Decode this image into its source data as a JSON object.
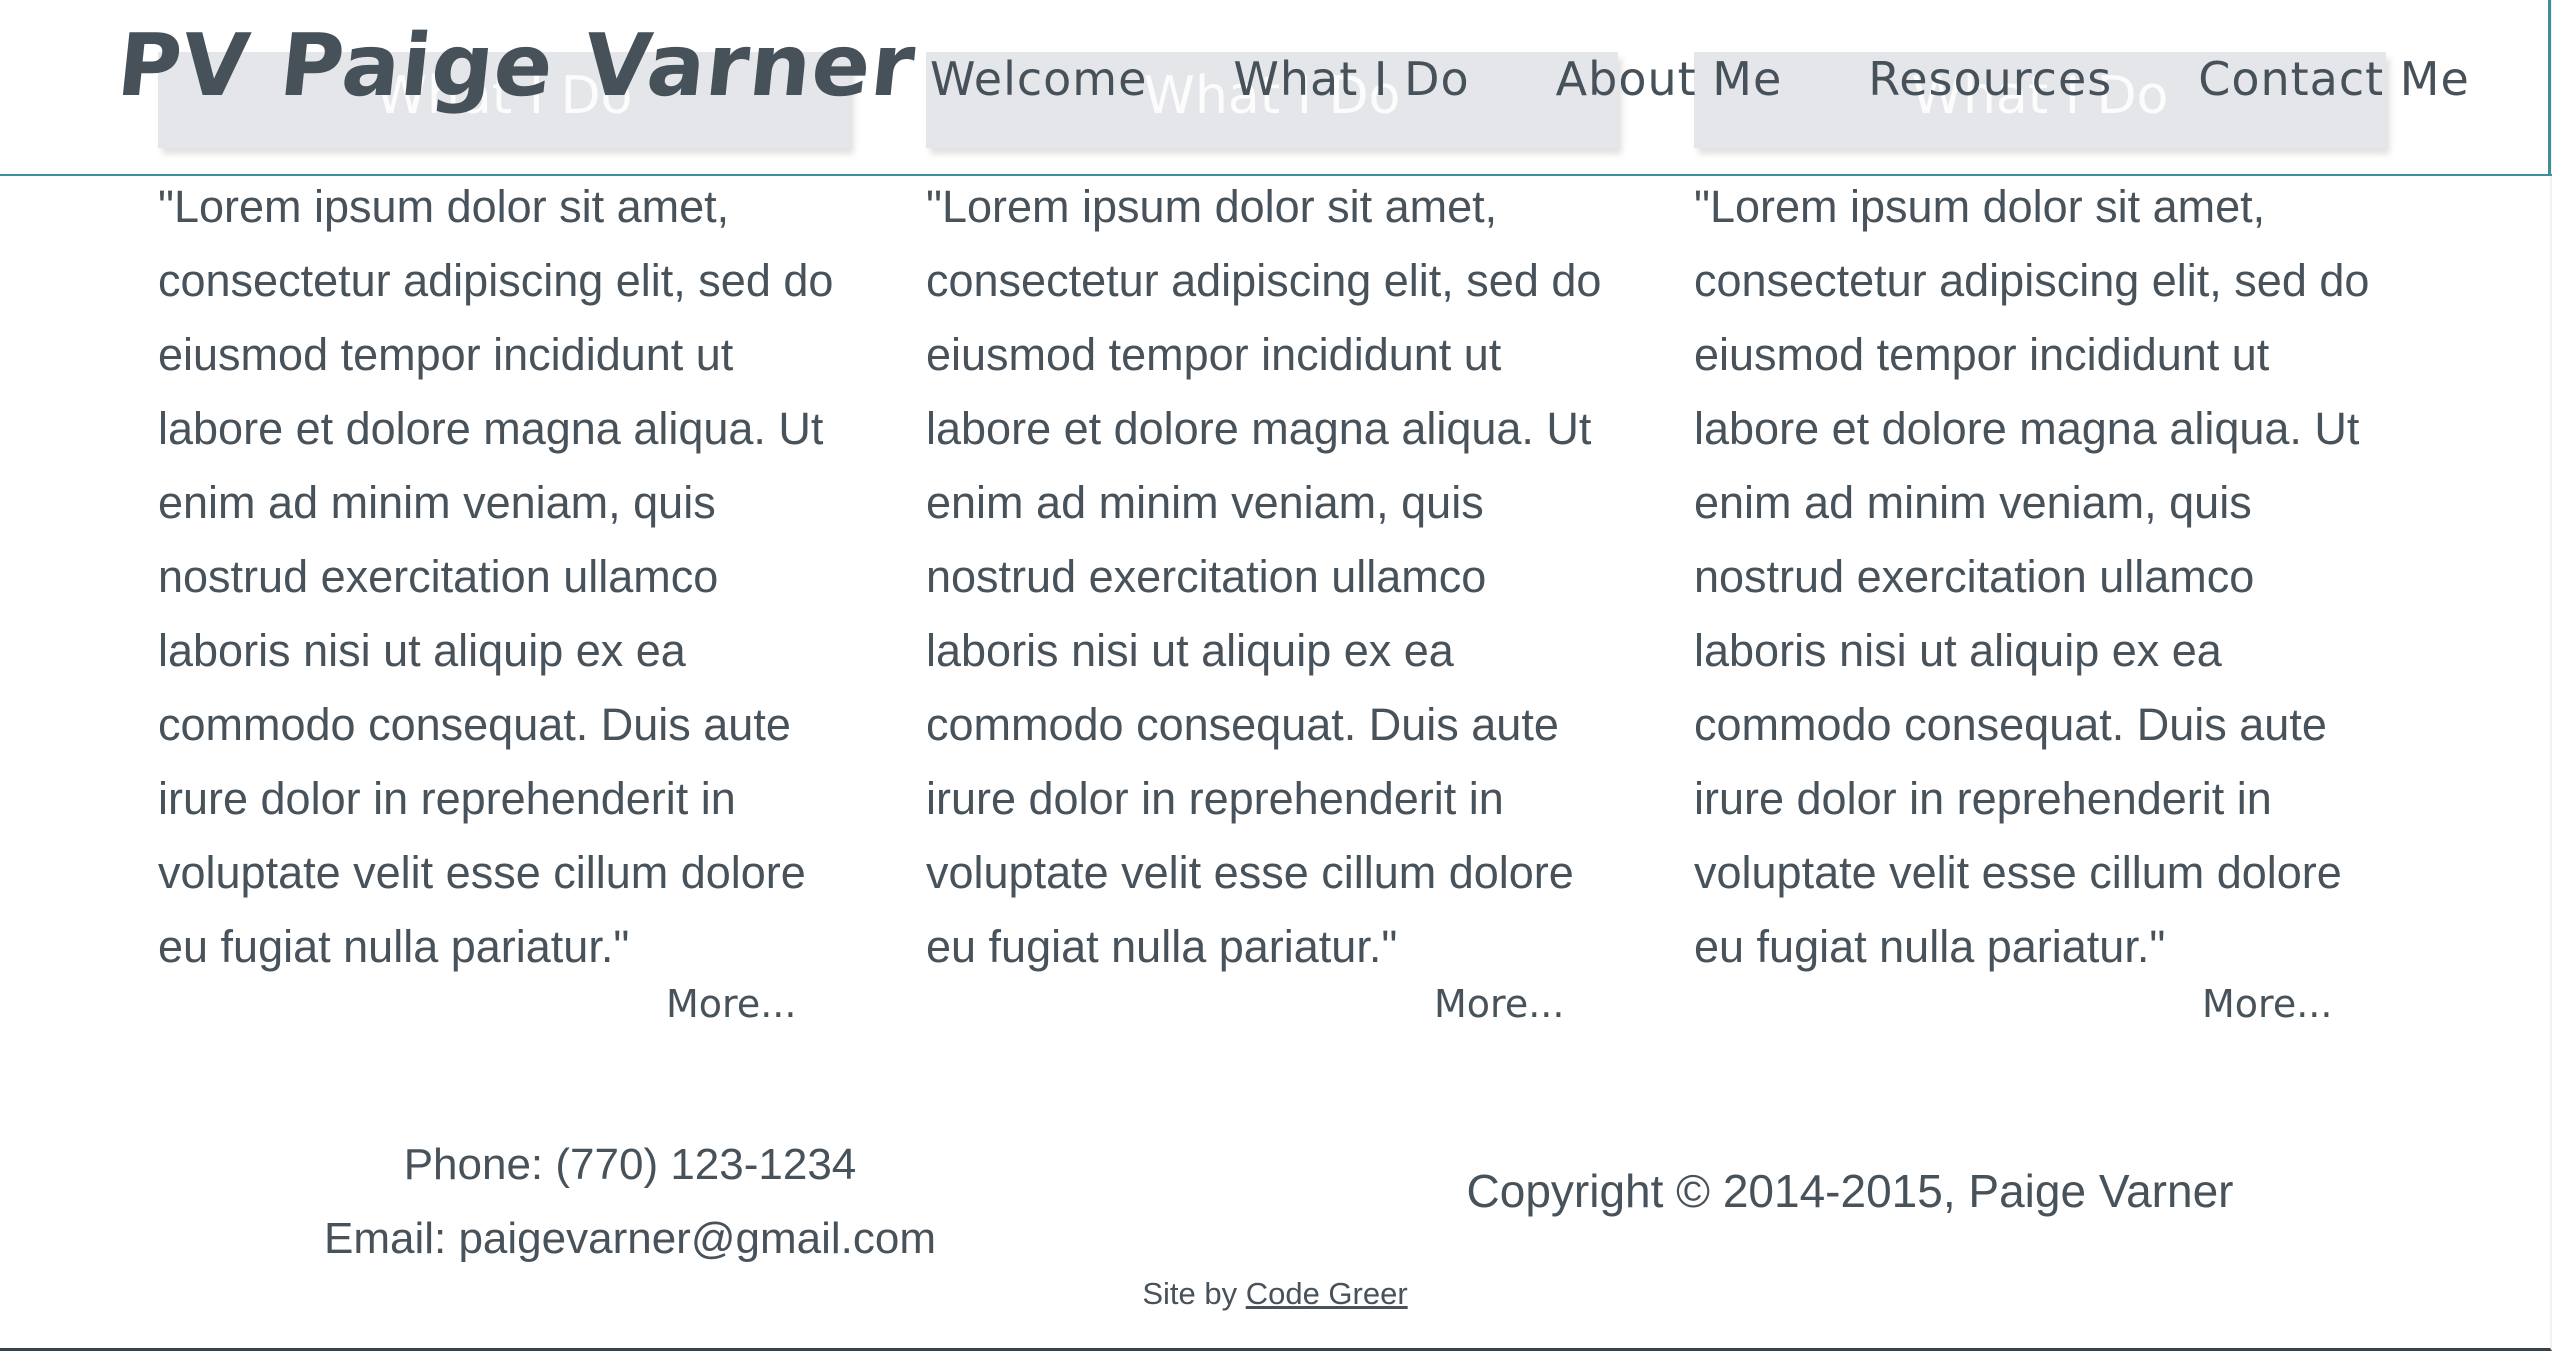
{
  "header": {
    "logo": "PV Paige Varner",
    "nav": [
      "Welcome",
      "What I Do",
      "About Me",
      "Resources",
      "Contact Me"
    ]
  },
  "cards": [
    {
      "heading": "What I Do",
      "body": "\"Lorem ipsum dolor sit amet, consectetur adipiscing elit, sed do eiusmod tempor incididunt ut labore et dolore magna aliqua. Ut enim ad minim veniam, quis nostrud exercitation ullamco laboris nisi ut aliquip ex ea commodo consequat. Duis aute irure dolor in reprehenderit in voluptate velit esse cillum dolore eu fugiat nulla pariatur.\"",
      "more": "More..."
    },
    {
      "heading": "What I Do",
      "body": "\"Lorem ipsum dolor sit amet, consectetur adipiscing elit, sed do eiusmod tempor incididunt ut labore et dolore magna aliqua. Ut enim ad minim veniam, quis nostrud exercitation ullamco laboris nisi ut aliquip ex ea commodo consequat. Duis aute irure dolor in reprehenderit in voluptate velit esse cillum dolore eu fugiat nulla pariatur.\"",
      "more": "More..."
    },
    {
      "heading": "What I Do",
      "body": "\"Lorem ipsum dolor sit amet, consectetur adipiscing elit, sed do eiusmod tempor incididunt ut labore et dolore magna aliqua. Ut enim ad minim veniam, quis nostrud exercitation ullamco laboris nisi ut aliquip ex ea commodo consequat. Duis aute irure dolor in reprehenderit in voluptate velit esse cillum dolore eu fugiat nulla pariatur.\"",
      "more": "More..."
    }
  ],
  "footer": {
    "phone": "Phone: (770) 123-1234",
    "email": "Email: paigevarner@gmail.com",
    "copyright": "Copyright © 2014-2015, Paige Varner",
    "credit_prefix": "Site by ",
    "credit_link": "Code Greer"
  },
  "colors": {
    "text": "#48525a",
    "header_rule": "#3e8f9a",
    "card_head_bg": "#e4e6e9"
  }
}
